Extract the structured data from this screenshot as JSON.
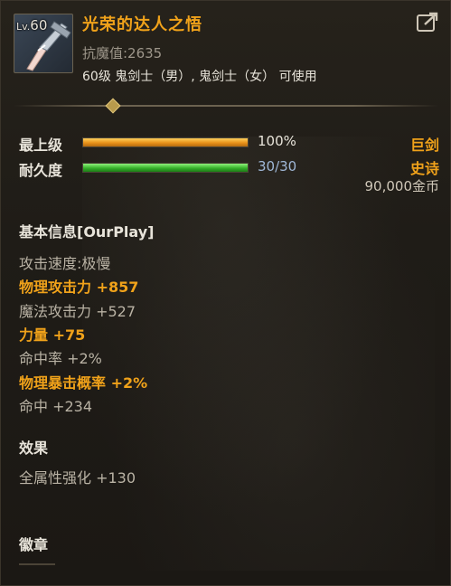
{
  "item": {
    "level_prefix": "Lv.",
    "level": "60",
    "name": "光荣的达人之悟",
    "resist_label": "抗魔值:2635",
    "usable_text": "60级 鬼剑士（男）, 鬼剑士（女） 可使用",
    "icon": "pickaxe-weapon-icon"
  },
  "bars": {
    "top_level": {
      "label": "最上级",
      "value_text": "100%",
      "fraction": 1.0,
      "color": "#f0a21a"
    },
    "durability": {
      "label": "耐久度",
      "value_text": "30/30",
      "fraction": 1.0,
      "color": "#36b22b",
      "value_color": "#9fb7d6"
    }
  },
  "tags": {
    "type": "巨剑",
    "rarity": "史诗",
    "price": "90,000金币"
  },
  "basic_info": {
    "title": "基本信息[OurPlay]",
    "stats": [
      {
        "text": "攻击速度:极慢",
        "style": "normal"
      },
      {
        "text": "物理攻击力 +857",
        "style": "bonus"
      },
      {
        "text": "魔法攻击力 +527",
        "style": "normal"
      },
      {
        "text": "力量 +75",
        "style": "bonus"
      },
      {
        "text": "命中率 +2%",
        "style": "normal"
      },
      {
        "text": "物理暴击概率 +2%",
        "style": "bonus"
      },
      {
        "text": "命中 +234",
        "style": "normal"
      }
    ]
  },
  "effects": {
    "title": "效果",
    "stats": [
      {
        "text": "全属性强化 +130",
        "style": "normal"
      }
    ]
  },
  "badge": {
    "title": "徽章"
  },
  "colors": {
    "accent": "#f0a21a",
    "text": "#e8e4da",
    "muted": "#b9b2a4"
  }
}
